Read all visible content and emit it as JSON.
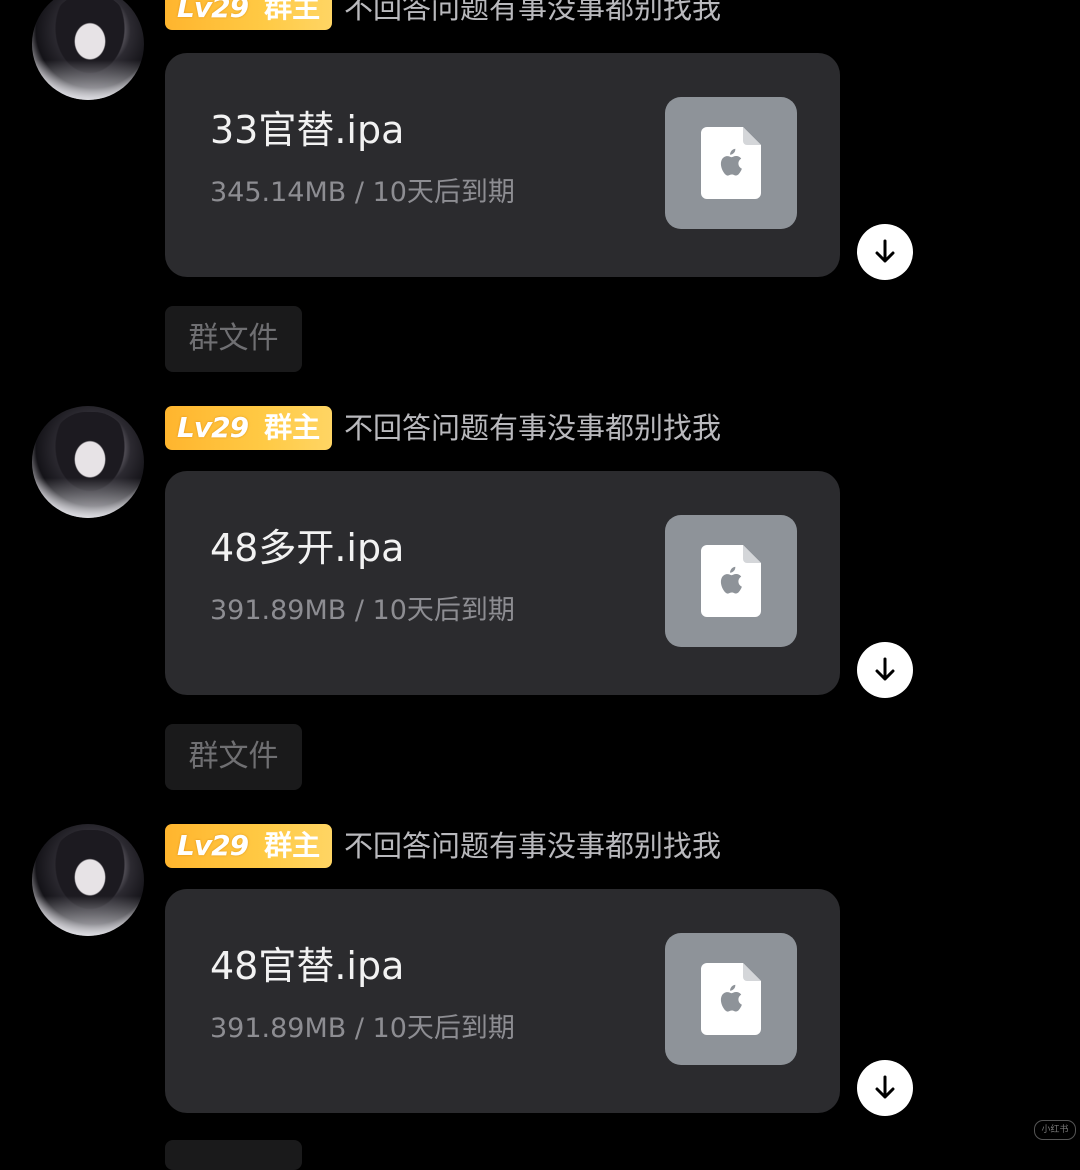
{
  "messages": [
    {
      "badge_level": "Lv29",
      "badge_role": "群主",
      "nickname": "不回答问题有事没事都别找我",
      "file_name": "33官替.ipa",
      "file_meta": "345.14MB / 10天后到期",
      "tag": "群文件"
    },
    {
      "badge_level": "Lv29",
      "badge_role": "群主",
      "nickname": "不回答问题有事没事都别找我",
      "file_name": "48多开.ipa",
      "file_meta": "391.89MB / 10天后到期",
      "tag": "群文件"
    },
    {
      "badge_level": "Lv29",
      "badge_role": "群主",
      "nickname": "不回答问题有事没事都别找我",
      "file_name": "48官替.ipa",
      "file_meta": "391.89MB / 10天后到期"
    }
  ],
  "icons": {
    "file_icon": "apple-file-icon",
    "download_icon": "arrow-down-icon"
  },
  "colors": {
    "background": "#000000",
    "card": "#2b2b2e",
    "badge_gradient_start": "#ffb52e",
    "badge_gradient_end": "#ffd564",
    "file_tile": "#8e9399",
    "nickname": "#b9b9bd",
    "meta": "#8d8d92"
  },
  "watermark": "小红书"
}
